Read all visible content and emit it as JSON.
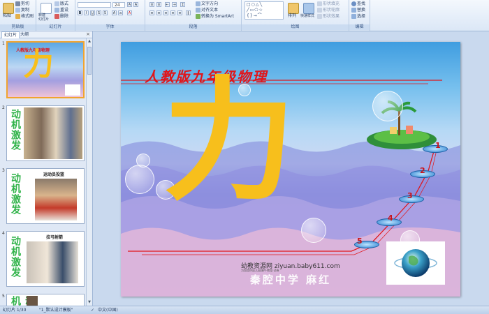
{
  "ribbon": {
    "clipboard": {
      "label": "剪贴板",
      "paste": "粘贴",
      "cut": "剪切",
      "copy": "复制",
      "format_painter": "格式刷"
    },
    "slides": {
      "label": "幻灯片",
      "new_slide": "新建\n幻灯片",
      "layout": "版式",
      "reset": "重设",
      "delete": "删除"
    },
    "font": {
      "label": "字体",
      "font_size": "24"
    },
    "paragraph": {
      "label": "段落",
      "text_direction": "文字方向",
      "align_text": "对齐文本",
      "smartart": "转换为 SmartArt"
    },
    "drawing": {
      "label": "绘图",
      "arrange": "排列",
      "quick_styles": "快速样式",
      "shape_fill": "形状填充",
      "shape_outline": "形状轮廓",
      "shape_effects": "形状效果"
    },
    "editing": {
      "label": "编辑",
      "find": "查找",
      "replace": "替换",
      "select": "选择"
    }
  },
  "left_pane": {
    "tabs": {
      "slides": "幻灯片",
      "outline": "大纲"
    },
    "close": "×",
    "thumbs": [
      {
        "num": "1",
        "title": "人教版九年级物理",
        "char": "力"
      },
      {
        "num": "2",
        "text": "动机激发"
      },
      {
        "num": "3",
        "text": "动机激发",
        "caption": "运动员投篮"
      },
      {
        "num": "4",
        "text": "动机激发",
        "caption": "拉弓射箭"
      },
      {
        "num": "5",
        "text": "动机"
      }
    ]
  },
  "slide": {
    "title": "人教版九年级物理",
    "char": "力",
    "steps": [
      "1",
      "2",
      "3",
      "4",
      "5"
    ],
    "watermark": "幼教资源网 ziyuan.baby611.com",
    "watermark_small": "为您提供幼儿园课件·教案·试卷",
    "school": "秦腔中学 麻红"
  },
  "status": {
    "slide": "幻灯片 1/30",
    "theme": "\"1_默认设计模板\"",
    "lang": "中文(中国)"
  },
  "colors": {
    "title_red": "#e0161b",
    "char_yellow": "#f7bf1c",
    "step_red": "#c8141a",
    "ribbon_bg": "#dbe7f6"
  }
}
